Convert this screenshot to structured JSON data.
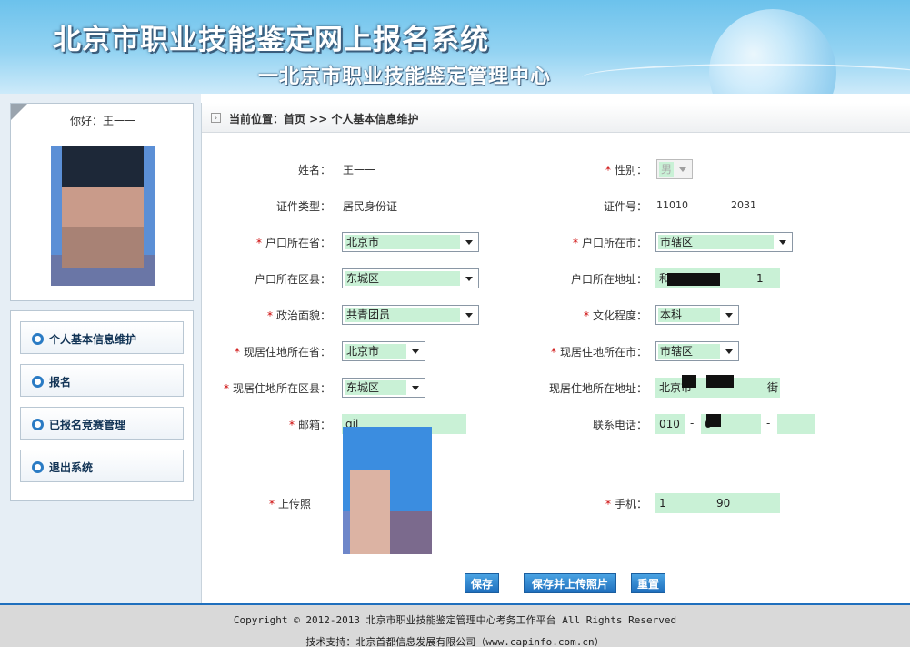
{
  "header": {
    "title": "北京市职业技能鉴定网上报名系统",
    "subtitle": "一北京市职业技能鉴定管理中心"
  },
  "user": {
    "greeting": "你好：王一一"
  },
  "menu": {
    "items": [
      {
        "label": "个人基本信息维护"
      },
      {
        "label": "报名"
      },
      {
        "label": "已报名竞赛管理"
      },
      {
        "label": "退出系统"
      }
    ]
  },
  "breadcrumb": {
    "text": "当前位置：首页 >> 个人基本信息维护"
  },
  "form": {
    "name_label": "姓名：",
    "name_value": "王一一",
    "gender_label": "性别：",
    "gender_value": "男",
    "idtype_label": "证件类型：",
    "idtype_value": "居民身份证",
    "idno_label": "证件号：",
    "idno_prefix": "11010",
    "idno_suffix": "2031",
    "hukou_province_label": "户口所在省：",
    "hukou_province_value": "北京市",
    "hukou_city_label": "户口所在市：",
    "hukou_city_value": "市辖区",
    "hukou_district_label": "户口所在区县：",
    "hukou_district_value": "东城区",
    "hukou_address_label": "户口所在地址：",
    "hukou_address_prefix": "和",
    "hukou_address_suffix": "1",
    "political_label": "政治面貌：",
    "political_value": "共青团员",
    "education_label": "文化程度：",
    "education_value": "本科",
    "res_province_label": "现居住地所在省：",
    "res_province_value": "北京市",
    "res_city_label": "现居住地所在市：",
    "res_city_value": "市辖区",
    "res_district_label": "现居住地所在区县：",
    "res_district_value": "东城区",
    "res_address_label": "现居住地所在地址：",
    "res_address_prefix": "北京市",
    "res_address_suffix": "街",
    "email_label": "邮箱：",
    "email_prefix": "qil",
    "phone_label": "联系电话：",
    "phone_area": "010",
    "phone_number": "6",
    "phone_dash": "-",
    "photo_label": "上传照",
    "mobile_label": "手机：",
    "mobile_prefix": "1",
    "mobile_suffix": "90"
  },
  "buttons": {
    "save": "保存",
    "save_upload": "保存并上传照片",
    "reset": "重置"
  },
  "footer": {
    "copyright": "Copyright © 2012-2013 北京市职业技能鉴定管理中心考务工作平台 All Rights Reserved",
    "support": "技术支持：北京首都信息发展有限公司（www.capinfo.com.cn）"
  }
}
